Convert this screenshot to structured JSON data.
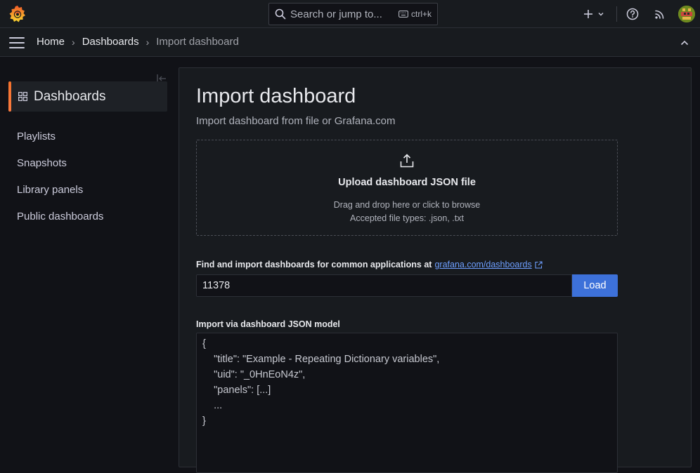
{
  "topbar": {
    "search_placeholder": "Search or jump to...",
    "search_shortcut": "ctrl+k",
    "icons": [
      "grafana-logo-icon",
      "search-icon",
      "keyboard-icon",
      "plus-icon",
      "chevron-down-icon",
      "help-icon",
      "rss-icon",
      "avatar"
    ]
  },
  "breadcrumb": {
    "items": [
      "Home",
      "Dashboards",
      "Import dashboard"
    ]
  },
  "sidebar": {
    "section_title": "Dashboards",
    "items": [
      {
        "label": "Playlists"
      },
      {
        "label": "Snapshots"
      },
      {
        "label": "Library panels"
      },
      {
        "label": "Public dashboards"
      }
    ]
  },
  "main": {
    "title": "Import dashboard",
    "subtitle": "Import dashboard from file or Grafana.com",
    "upload": {
      "title": "Upload dashboard JSON file",
      "hint": "Drag and drop here or click to browse",
      "types": "Accepted file types: .json, .txt"
    },
    "find_label": "Find and import dashboards for common applications at",
    "find_link": "grafana.com/dashboards",
    "dashboard_id_value": "11378",
    "load_button": "Load",
    "json_label": "Import via dashboard JSON model",
    "json_lines": [
      "{",
      "    \"title\": \"Example - Repeating Dictionary variables\",",
      "    \"uid\": \"_0HnEoN4z\",",
      "    \"panels\": [...]",
      "    ...",
      "}"
    ]
  },
  "colors": {
    "accent_orange": "#f5722d",
    "primary_blue": "#3d71d9",
    "link_blue": "#6e9fff",
    "background": "#111217",
    "panel": "#181b1f"
  }
}
